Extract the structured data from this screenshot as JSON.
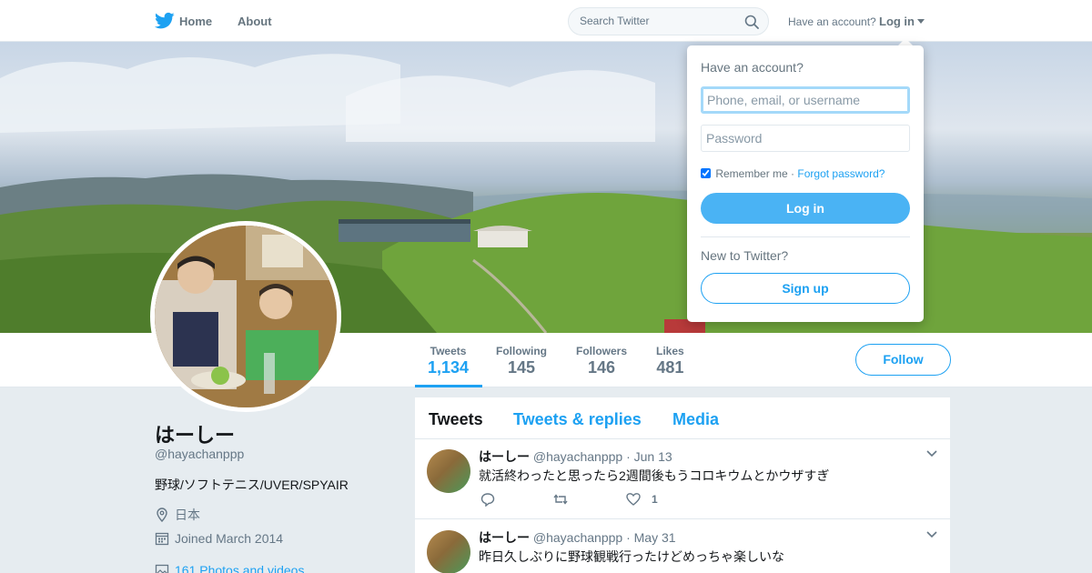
{
  "nav": {
    "home_label": "Home",
    "about_label": "About",
    "search_placeholder": "Search Twitter",
    "have_account": "Have an account?",
    "login_label": "Log in"
  },
  "login_dropdown": {
    "title": "Have an account?",
    "username_placeholder": "Phone, email, or username",
    "password_placeholder": "Password",
    "remember_me": "Remember me",
    "separator": "·",
    "forgot_password": "Forgot password?",
    "login_button": "Log in",
    "new_to_twitter": "New to Twitter?",
    "signup_button": "Sign up"
  },
  "profile": {
    "name": "はーしー",
    "handle": "@hayachanppp",
    "bio": "野球/ソフトテニス/UVER/SPYAIR",
    "location": "日本",
    "joined": "Joined March 2014",
    "photos_link": "161 Photos and videos"
  },
  "stats": [
    {
      "label": "Tweets",
      "value": "1,134",
      "active": true
    },
    {
      "label": "Following",
      "value": "145",
      "active": false
    },
    {
      "label": "Followers",
      "value": "146",
      "active": false
    },
    {
      "label": "Likes",
      "value": "481",
      "active": false
    }
  ],
  "follow_button": "Follow",
  "timeline_tabs": [
    {
      "label": "Tweets",
      "active": true
    },
    {
      "label": "Tweets & replies",
      "active": false
    },
    {
      "label": "Media",
      "active": false
    }
  ],
  "tweets": [
    {
      "name": "はーしー",
      "handle": "@hayachanppp",
      "date": "· Jun 13",
      "text": "就活終わったと思ったら2週間後もうコロキウムとかウザすぎ",
      "like_count": "1"
    },
    {
      "name": "はーしー",
      "handle": "@hayachanppp",
      "date": "· May 31",
      "text": "昨日久しぶりに野球観戦行ったけどめっちゃ楽しいな",
      "like_count": ""
    }
  ],
  "colors": {
    "accent": "#1da1f2",
    "text_secondary": "#657786",
    "background": "#e6ecf0"
  }
}
